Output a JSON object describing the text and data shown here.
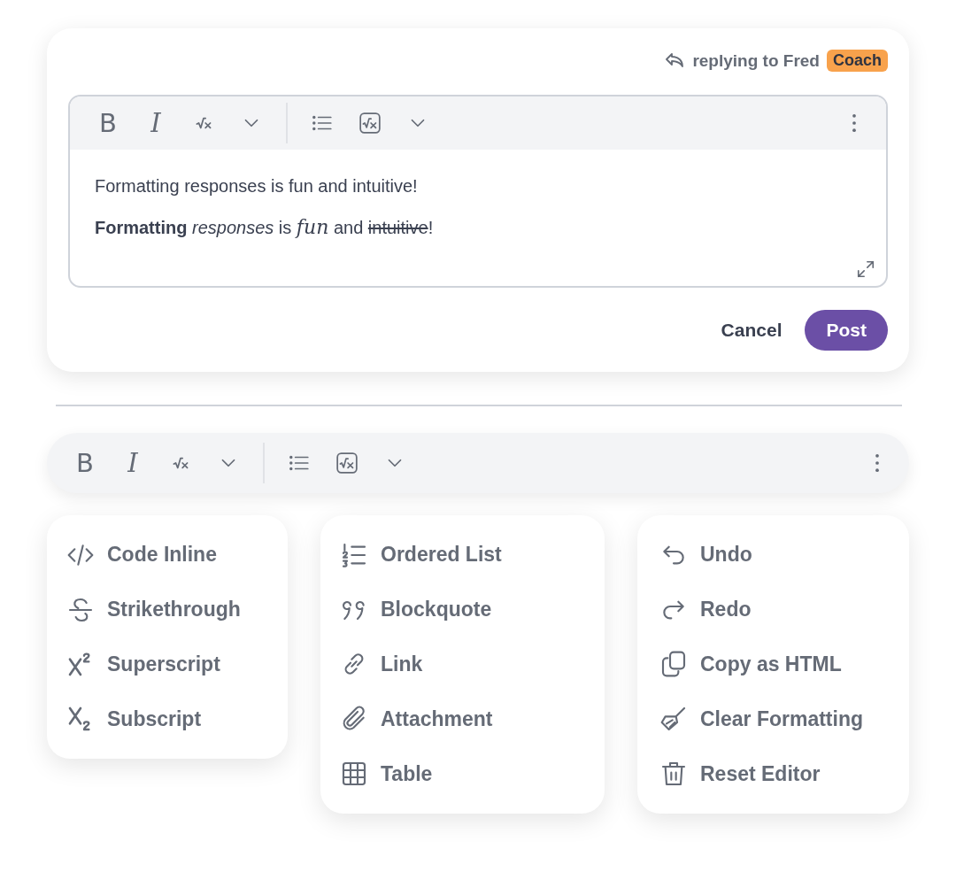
{
  "reply": {
    "prefix": "replying to Fred",
    "role": "Coach"
  },
  "editor_toolbar": [
    {
      "kind": "bold",
      "label": "B"
    },
    {
      "kind": "italic",
      "label": "I"
    },
    {
      "kind": "math"
    },
    {
      "kind": "caret"
    },
    {
      "kind": "divider"
    },
    {
      "kind": "list"
    },
    {
      "kind": "mathbox"
    },
    {
      "kind": "caret"
    },
    {
      "kind": "more"
    }
  ],
  "editor_lines": [
    [
      {
        "kind": "plain",
        "text": "Formatting responses is fun and intuitive!"
      }
    ],
    [
      {
        "kind": "bold",
        "text": "Formatting"
      },
      {
        "kind": "italic",
        "text": "responses"
      },
      {
        "kind": "plain",
        "text": " is "
      },
      {
        "kind": "math",
        "text": "fun"
      },
      {
        "kind": "plain",
        "text": " and "
      },
      {
        "kind": "strike",
        "text": "intuitive"
      },
      {
        "kind": "plain",
        "text": "!"
      }
    ]
  ],
  "actions": [
    {
      "kind": "text",
      "label": "Cancel"
    },
    {
      "kind": "primary",
      "label": "Post"
    }
  ],
  "toolbar": [
    {
      "kind": "bold",
      "label": "B"
    },
    {
      "kind": "italic",
      "label": "I"
    },
    {
      "kind": "math"
    },
    {
      "kind": "caret"
    },
    {
      "kind": "divider"
    },
    {
      "kind": "list"
    },
    {
      "kind": "mathbox"
    },
    {
      "kind": "caret"
    },
    {
      "kind": "more"
    }
  ],
  "menus": [
    [
      {
        "kind": "code",
        "label": "Code Inline"
      },
      {
        "kind": "strike",
        "label": "Strikethrough"
      },
      {
        "kind": "sup",
        "label": "Superscript"
      },
      {
        "kind": "sub",
        "label": "Subscript"
      }
    ],
    [
      {
        "kind": "ordered",
        "label": "Ordered List"
      },
      {
        "kind": "quote",
        "label": "Blockquote"
      },
      {
        "kind": "link",
        "label": "Link"
      },
      {
        "kind": "clip",
        "label": "Attachment"
      },
      {
        "kind": "table",
        "label": "Table"
      }
    ],
    [
      {
        "kind": "undo",
        "label": "Undo"
      },
      {
        "kind": "redo",
        "label": "Redo"
      },
      {
        "kind": "copy",
        "label": "Copy as HTML"
      },
      {
        "kind": "broom",
        "label": "Clear Formatting"
      },
      {
        "kind": "trash",
        "label": "Reset Editor"
      }
    ]
  ]
}
